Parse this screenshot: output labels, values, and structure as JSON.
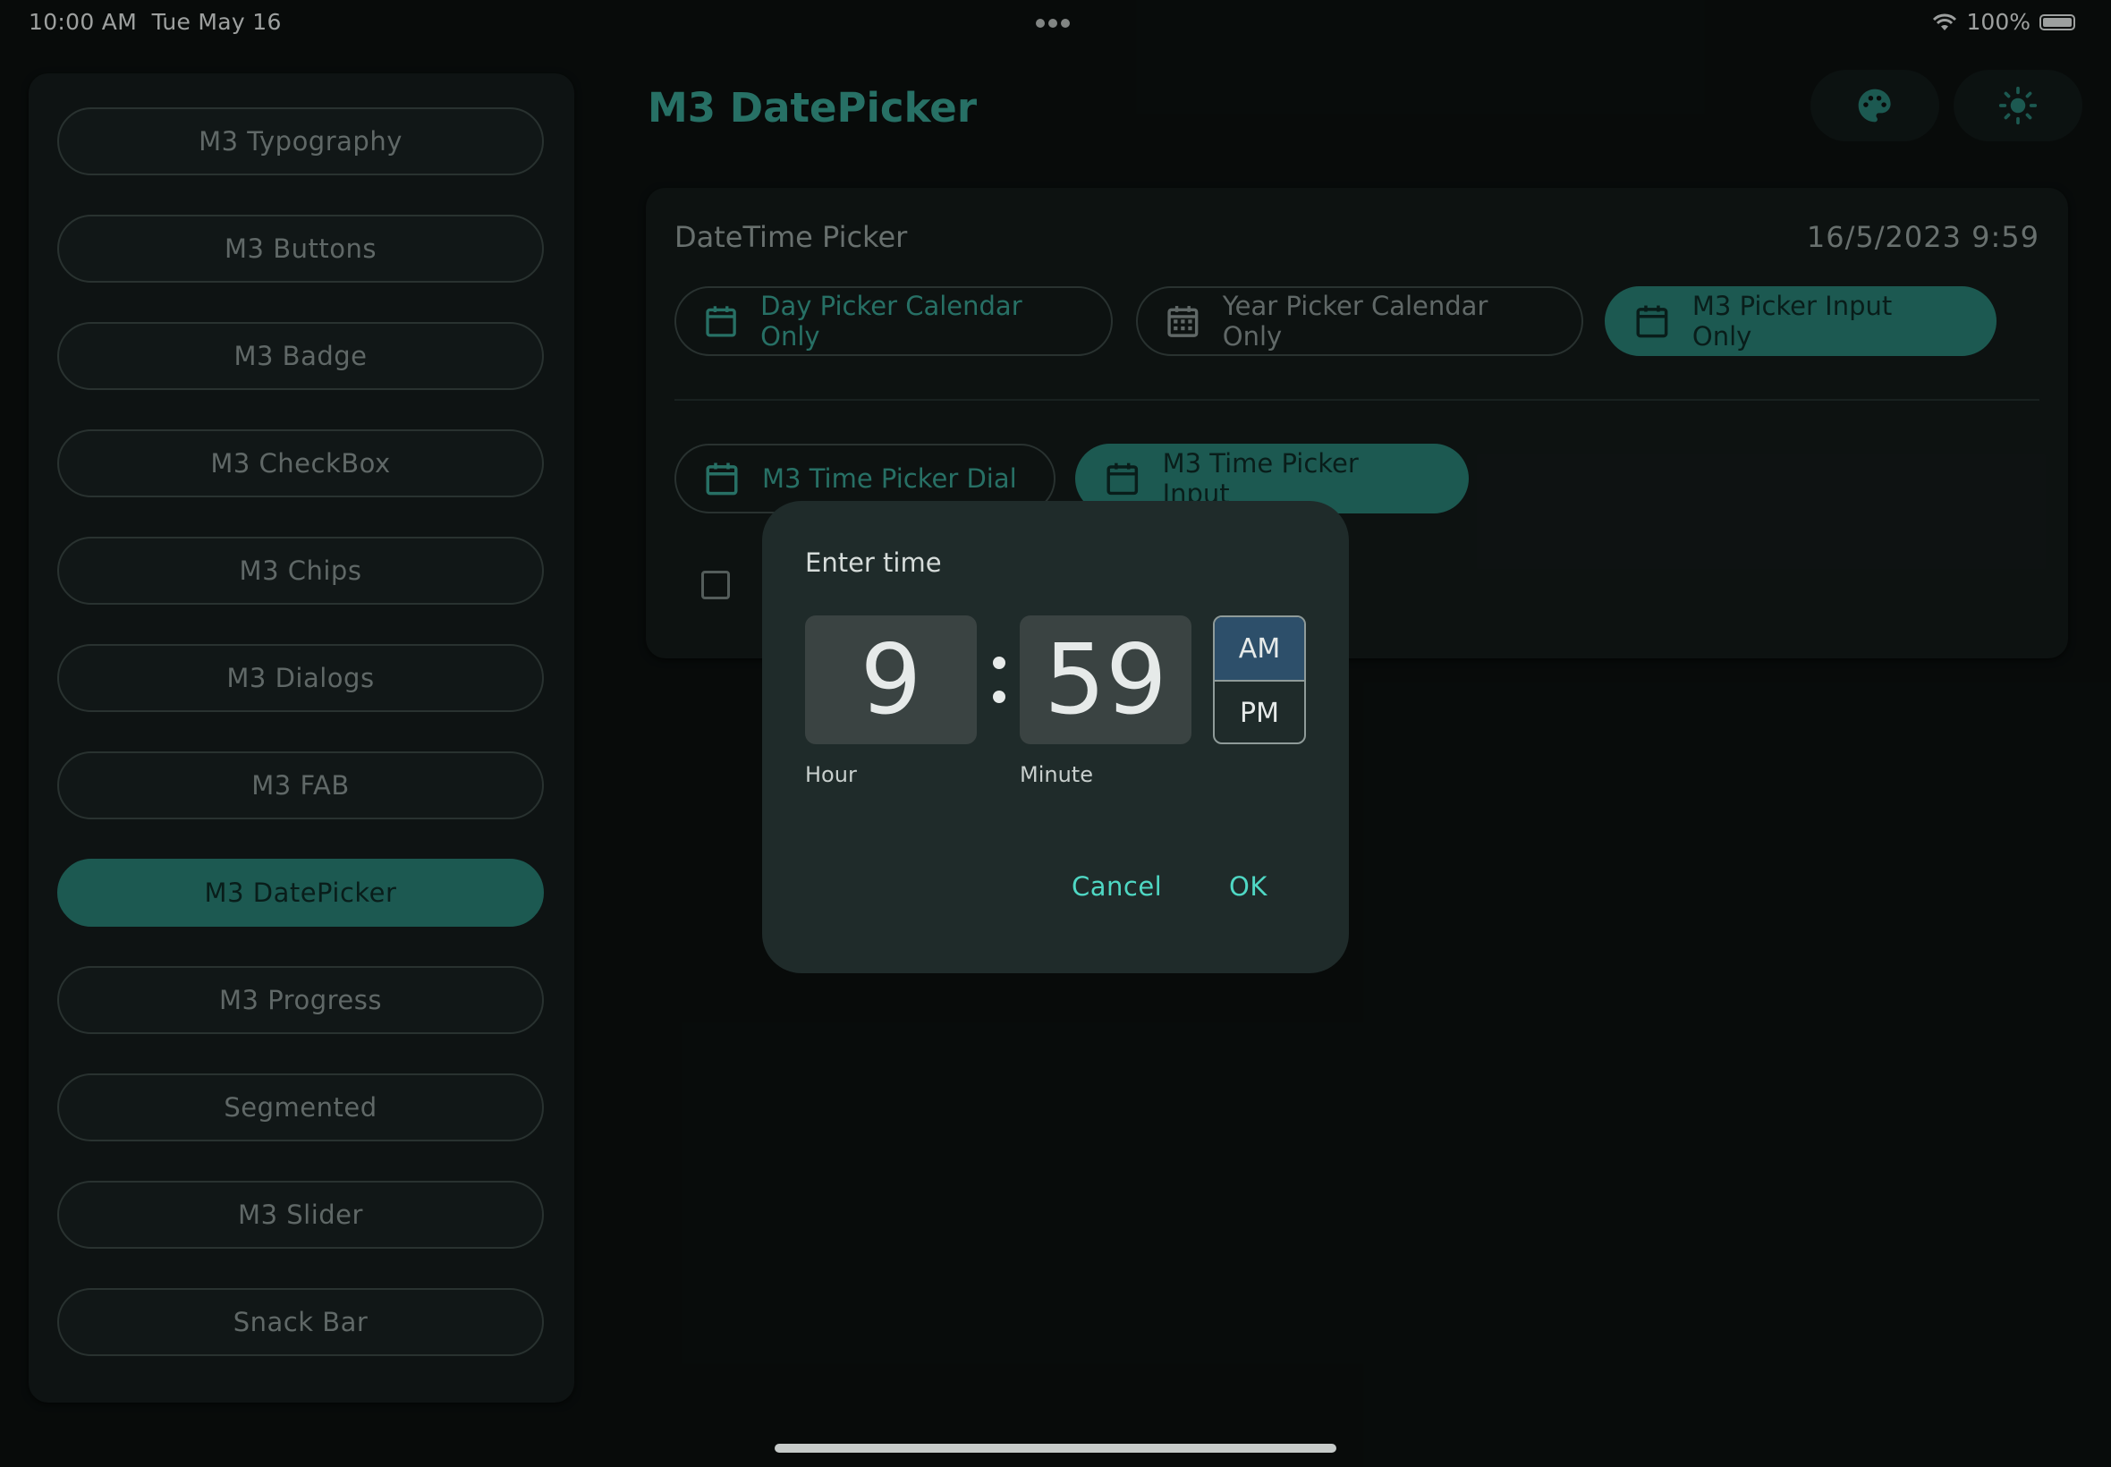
{
  "status_bar": {
    "time": "10:00 AM",
    "date": "Tue May 16",
    "battery": "100%"
  },
  "sidebar": {
    "items": [
      {
        "label": "M3 Typography",
        "active": false
      },
      {
        "label": "M3 Buttons",
        "active": false
      },
      {
        "label": "M3 Badge",
        "active": false
      },
      {
        "label": "M3 CheckBox",
        "active": false
      },
      {
        "label": "M3 Chips",
        "active": false
      },
      {
        "label": "M3 Dialogs",
        "active": false
      },
      {
        "label": "M3 FAB",
        "active": false
      },
      {
        "label": "M3 DatePicker",
        "active": true
      },
      {
        "label": "M3 Progress",
        "active": false
      },
      {
        "label": "Segmented",
        "active": false
      },
      {
        "label": "M3 Slider",
        "active": false
      },
      {
        "label": "Snack Bar",
        "active": false
      }
    ]
  },
  "header": {
    "title": "M3 DatePicker",
    "palette_icon": "palette-icon",
    "theme_icon": "brightness-icon"
  },
  "card": {
    "title": "DateTime Picker",
    "value": "16/5/2023 9:59",
    "buttons": {
      "day_picker": "Day Picker Calendar Only",
      "year_picker": "Year Picker Calendar Only",
      "picker_input": "M3 Picker Input Only",
      "time_dial": "M3 Time Picker Dial",
      "time_input": "M3 Time Picker Input"
    }
  },
  "dialog": {
    "title": "Enter time",
    "hour": "9",
    "minute": "59",
    "am": "AM",
    "pm": "PM",
    "period_selected": "AM",
    "hour_label": "Hour",
    "minute_label": "Minute",
    "cancel": "Cancel",
    "ok": "OK"
  },
  "colors": {
    "accent": "#3aa596",
    "accent_filled": "#2a8478",
    "action": "#4fd8c4",
    "am_selected": "#2d4f6a"
  }
}
